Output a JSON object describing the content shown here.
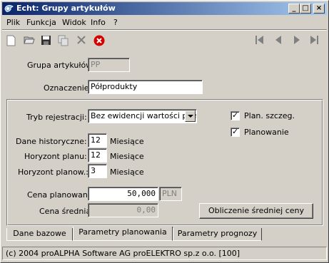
{
  "window": {
    "title": "Echt: Grupy artykułów"
  },
  "menu": [
    {
      "label": "Plik"
    },
    {
      "label": "Funkcja"
    },
    {
      "label": "Widok"
    },
    {
      "label": "Info"
    },
    {
      "label": "?"
    }
  ],
  "toolbar": {
    "icons": [
      "new-file-icon",
      "open-folder-icon",
      "save-icon",
      "copy-icon",
      "delete-icon",
      "cancel-icon",
      "first-record-icon",
      "previous-record-icon",
      "next-record-icon",
      "last-record-icon"
    ]
  },
  "form": {
    "group_label": "Grupa artykułów:",
    "group_value": "PP",
    "designation_label": "Oznaczenie:",
    "designation_value": "Półprodukty"
  },
  "panel": {
    "registration_label": "Tryb rejestracji:",
    "registration_value": "Bez ewidencji wartości plan",
    "history_label": "Dane historyczne:",
    "history_value": "12",
    "horizon_plan_label": "Horyzont planu:",
    "horizon_plan_value": "12",
    "horizon_planning_label": "Horyzont planow.:",
    "horizon_planning_value": "3",
    "months_unit": "Miesiące",
    "plan_detail_label": "Plan. szczeg.",
    "plan_detail_checked": true,
    "planning_label": "Planowanie",
    "planning_checked": true,
    "planned_price_label": "Cena planowana:",
    "planned_price_value": "50,000",
    "currency": "PLN",
    "avg_price_label": "Cena średnia:",
    "avg_price_value": "0,00",
    "calc_avg_button": "Obliczenie średniej ceny"
  },
  "tabs": [
    {
      "label": "Dane bazowe"
    },
    {
      "label": "Parametry planowania",
      "active": true
    },
    {
      "label": "Parametry prognozy"
    }
  ],
  "status": {
    "text": "(c) 2004 proALPHA Software AG  proELEKTRO sp.z o.o. [100]"
  }
}
